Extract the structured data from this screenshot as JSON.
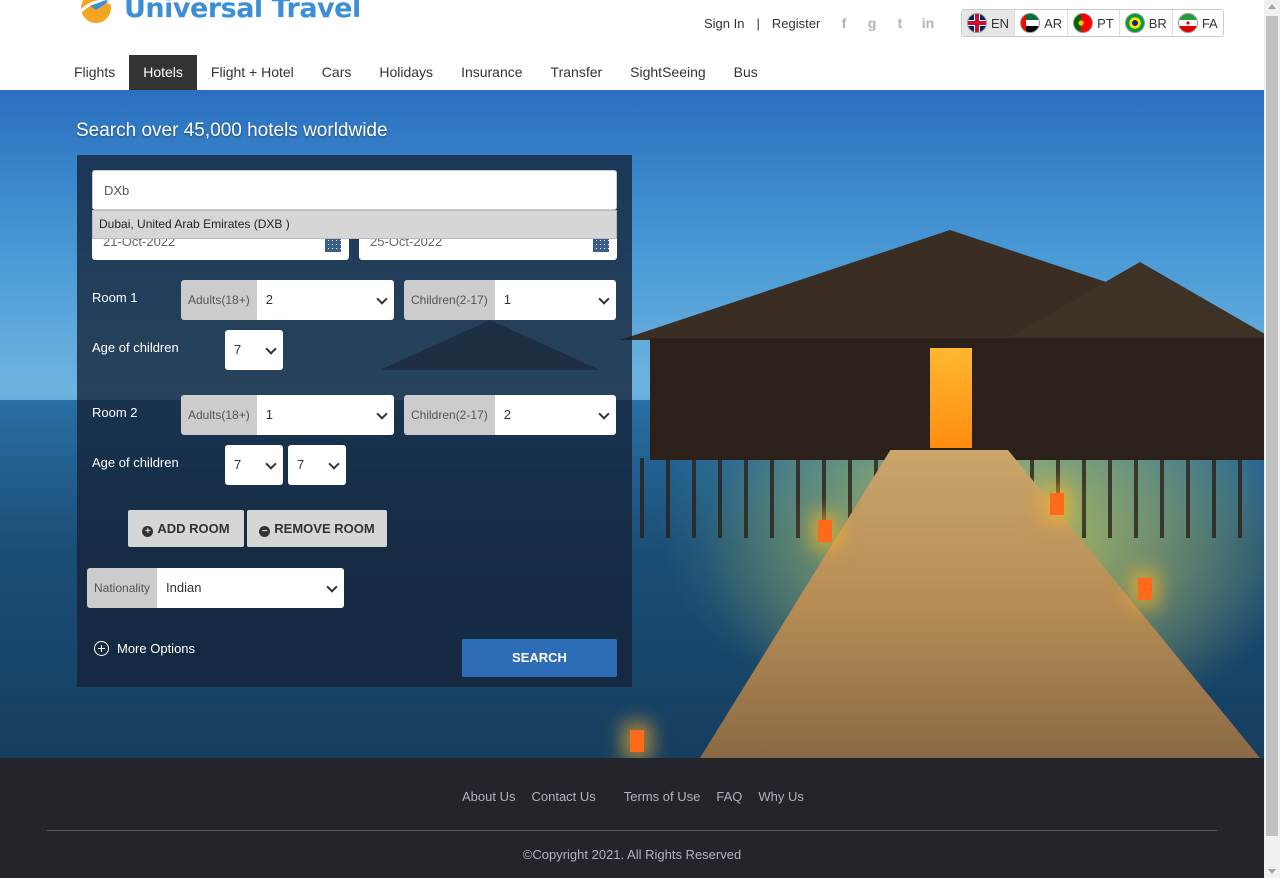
{
  "brand": {
    "name": "Universal Travel"
  },
  "header": {
    "sign_in": "Sign In",
    "separator": "|",
    "register": "Register",
    "social": [
      "facebook-icon",
      "google-icon",
      "twitter-icon",
      "linkedin-icon"
    ],
    "languages": [
      {
        "code": "EN",
        "flag": "uk-flag-icon",
        "active": true
      },
      {
        "code": "AR",
        "flag": "uae-flag-icon"
      },
      {
        "code": "PT",
        "flag": "portugal-flag-icon"
      },
      {
        "code": "BR",
        "flag": "brazil-flag-icon"
      },
      {
        "code": "FA",
        "flag": "iran-flag-icon"
      }
    ]
  },
  "nav": {
    "items": [
      "Flights",
      "Hotels",
      "Flight + Hotel",
      "Cars",
      "Holidays",
      "Insurance",
      "Transfer",
      "SightSeeing",
      "Bus"
    ],
    "active": "Hotels"
  },
  "hero": {
    "title": "Search over 45,000 hotels worldwide"
  },
  "search": {
    "destination_value": "DXb",
    "suggestion": "Dubai, United Arab Emirates (DXB )",
    "checkin": "21-Oct-2022",
    "checkout": "25-Oct-2022",
    "rooms": [
      {
        "label": "Room 1",
        "adults_label": "Adults(18+)",
        "adults": "2",
        "children_label": "Children(2-17)",
        "children": "1",
        "ages_label": "Age of children",
        "ages": [
          "7"
        ]
      },
      {
        "label": "Room 2",
        "adults_label": "Adults(18+)",
        "adults": "1",
        "children_label": "Children(2-17)",
        "children": "2",
        "ages_label": "Age of children",
        "ages": [
          "7",
          "7"
        ]
      }
    ],
    "add_room": "ADD ROOM",
    "remove_room": "REMOVE ROOM",
    "nationality_label": "Nationality",
    "nationality": "Indian",
    "more_options": "More Options",
    "search_button": "SEARCH"
  },
  "footer": {
    "links": [
      "About Us",
      "Contact Us",
      "Terms of Use",
      "FAQ",
      "Why Us"
    ],
    "copyright": "©Copyright 2021. All Rights Reserved"
  },
  "colors": {
    "brand_blue": "#3a8fd6",
    "search_button": "#2d6db5",
    "nav_active": "#333333",
    "footer_bg": "#23252b"
  }
}
